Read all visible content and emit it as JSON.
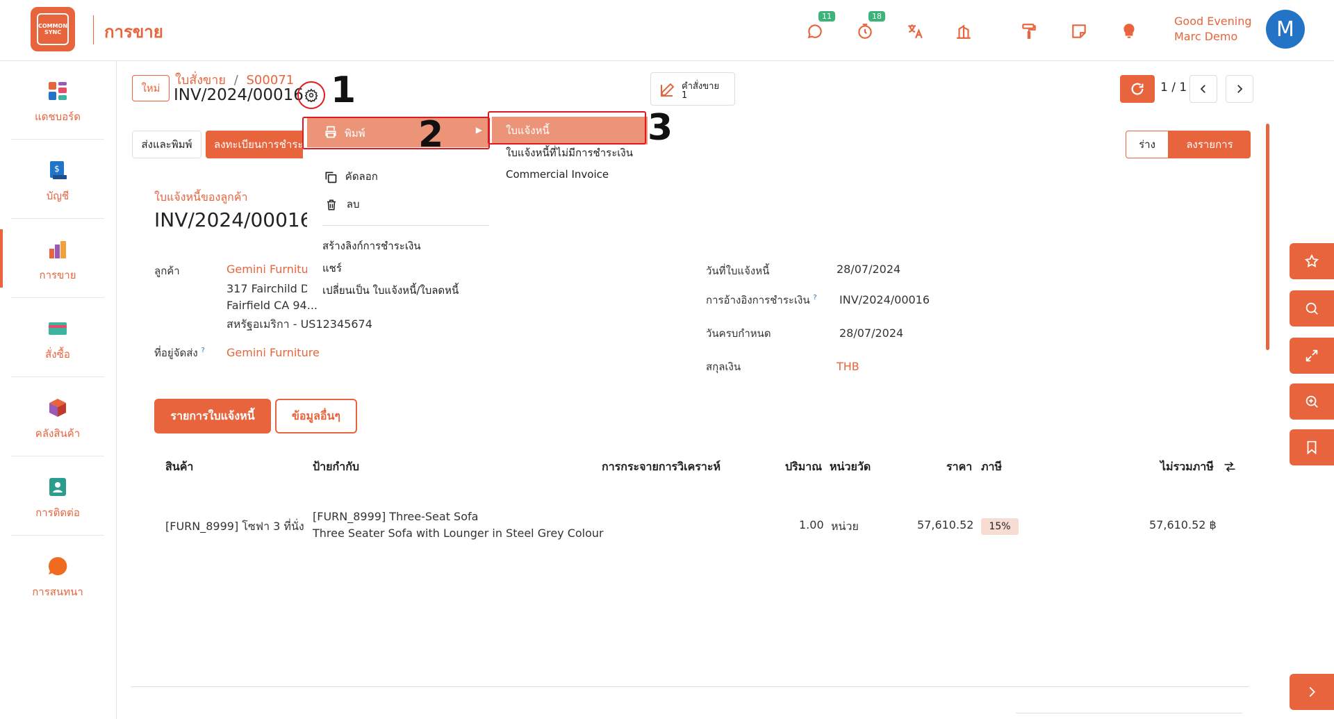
{
  "app": {
    "logo_text": "COMMON SYNC",
    "title": "การขาย",
    "greeting": "Good Evening",
    "user_name": "Marc Demo",
    "avatar_letter": "M"
  },
  "topbar": {
    "icons": [
      {
        "name": "chat-icon",
        "badge": "11"
      },
      {
        "name": "timer-icon",
        "badge": "18"
      },
      {
        "name": "translate-icon",
        "badge": ""
      },
      {
        "name": "building-icon",
        "badge": ""
      },
      {
        "name": "paint-roller-icon",
        "badge": ""
      },
      {
        "name": "note-icon",
        "badge": ""
      },
      {
        "name": "lightbulb-icon",
        "badge": ""
      }
    ]
  },
  "sidebar": {
    "items": [
      {
        "label": "แดชบอร์ด",
        "icon": "dashboard-icon"
      },
      {
        "label": "บัญชี",
        "icon": "accounting-icon"
      },
      {
        "label": "การขาย",
        "icon": "sales-icon",
        "active": true
      },
      {
        "label": "สั่งซื้อ",
        "icon": "purchase-icon"
      },
      {
        "label": "คลังสินค้า",
        "icon": "inventory-icon"
      },
      {
        "label": "การติดต่อ",
        "icon": "contacts-icon"
      },
      {
        "label": "การสนทนา",
        "icon": "discuss-icon"
      }
    ]
  },
  "breadcrumb": {
    "new_label": "ใหม่",
    "parent": "ใบสั่งขาย",
    "separator": "/",
    "order": "S00071",
    "record": "INV/2024/00016"
  },
  "smart_button": {
    "label": "คำสั่งขาย",
    "count": "1"
  },
  "pager": {
    "text": "1 / 1"
  },
  "actions": {
    "send_print": "ส่งและพิมพ์",
    "register_payment": "ลงทะเบียนการชำระ"
  },
  "status": {
    "draft": "ร่าง",
    "posted": "ลงรายการ"
  },
  "annotations": {
    "step1": "1",
    "step2": "2",
    "step3": "3"
  },
  "gear_menu": {
    "print": "พิมพ์",
    "copy": "คัดลอก",
    "delete": "ลบ",
    "payment_link": "สร้างลิงก์การชำระเงิน",
    "share": "แชร์",
    "convert": "เปลี่ยนเป็น ใบแจ้งหนี้/ใบลดหนี้"
  },
  "print_submenu": {
    "invoice": "ใบแจ้งหนี้",
    "invoice_no_payment": "ใบแจ้งหนี้ที่ไม่มีการชำระเงิน",
    "commercial": "Commercial Invoice"
  },
  "form": {
    "doc_type": "ใบแจ้งหนี้ของลูกค้า",
    "doc_name": "INV/2024/00016",
    "customer_label": "ลูกค้า",
    "customer_name": "Gemini Furnitu",
    "address_1": "317 Fairchild Dı",
    "address_2": "Fairfield CA 94...",
    "address_3": "สหรัฐอเมริกา - US12345674",
    "delivery_label": "ที่อยู่จัดส่ง",
    "delivery_help": "?",
    "delivery_value": "Gemini Furniture",
    "invoice_date_label": "วันที่ใบแจ้งหนี้",
    "invoice_date": "28/07/2024",
    "payment_ref_label": "การอ้างอิงการชำระเงิน",
    "payment_ref_help": "?",
    "payment_ref": "INV/2024/00016",
    "due_date_label": "วันครบกำหนด",
    "due_date": "28/07/2024",
    "currency_label": "สกุลเงิน",
    "currency": "THB"
  },
  "tabs": {
    "lines": "รายการใบแจ้งหนี้",
    "other": "ข้อมูลอื่นๆ"
  },
  "table": {
    "headers": {
      "product": "สินค้า",
      "label": "ป้ายกำกับ",
      "analytic": "การกระจายการวิเคราะห์",
      "qty": "ปริมาณ",
      "uom": "หน่วยวัด",
      "price": "ราคา",
      "tax": "ภาษี",
      "subtotal": "ไม่รวมภาษี"
    },
    "rows": [
      {
        "product": "[FURN_8999] โซฟา 3 ที่นั่ง",
        "label_1": "[FURN_8999] Three-Seat Sofa",
        "label_2": "Three Seater Sofa with Lounger in Steel Grey Colour",
        "qty": "1.00",
        "uom": "หน่วย",
        "price": "57,610.52",
        "tax": "15%",
        "subtotal": "57,610.52 ฿"
      }
    ]
  },
  "colors": {
    "accent": "#e8643c",
    "highlight": "#eb9478",
    "annotation": "#e0191f",
    "avatar": "#2374c6",
    "badge": "#3db37a"
  }
}
